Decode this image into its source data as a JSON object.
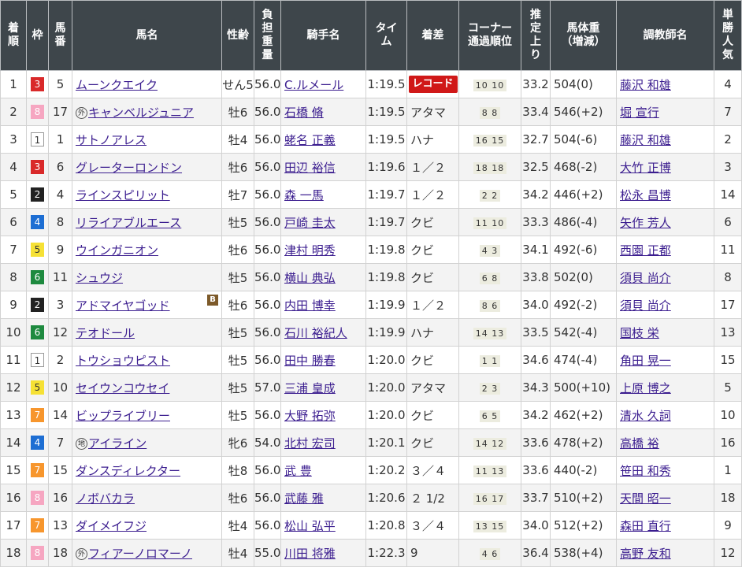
{
  "headers": [
    "着順",
    "枠",
    "馬番",
    "馬名",
    "性齢",
    "負担重量",
    "騎手名",
    "タイム",
    "着差",
    "コーナー通過順位",
    "推定上り",
    "馬体重(増減)",
    "調教師名",
    "単勝人気"
  ],
  "header_lines": [
    [
      "着",
      "順"
    ],
    [
      "枠"
    ],
    [
      "馬",
      "番"
    ],
    [
      "馬名"
    ],
    [
      "性齢"
    ],
    [
      "負",
      "担",
      "重",
      "量"
    ],
    [
      "騎手名"
    ],
    [
      "タイ",
      "ム"
    ],
    [
      "着差"
    ],
    [
      "コーナー",
      "通過順位"
    ],
    [
      "推",
      "定",
      "上",
      "り"
    ],
    [
      "馬体重",
      "（増減）"
    ],
    [
      "調教師名"
    ],
    [
      "単",
      "勝",
      "人",
      "気"
    ]
  ],
  "rows": [
    {
      "pos": "1",
      "waku": "3",
      "num": "5",
      "mark": "",
      "name": "ムーンクエイク",
      "blinker": "",
      "sex": "せん5",
      "wt": "56.0",
      "jockey": "C.ルメール",
      "time": "1:19.5",
      "margin": "",
      "record": "レコード",
      "corner": "10 10",
      "last": "33.2",
      "body": "504(0)",
      "trainer": "藤沢 和雄",
      "pop": "4"
    },
    {
      "pos": "2",
      "waku": "8",
      "num": "17",
      "mark": "外",
      "name": "キャンベルジュニア",
      "blinker": "",
      "sex": "牡6",
      "wt": "56.0",
      "jockey": "石橋 脩",
      "time": "1:19.5",
      "margin": "アタマ",
      "record": "",
      "corner": "8 8",
      "last": "33.4",
      "body": "546(+2)",
      "trainer": "堀 宣行",
      "pop": "7"
    },
    {
      "pos": "3",
      "waku": "1",
      "num": "1",
      "mark": "",
      "name": "サトノアレス",
      "blinker": "",
      "sex": "牡4",
      "wt": "56.0",
      "jockey": "蛯名 正義",
      "time": "1:19.5",
      "margin": "ハナ",
      "record": "",
      "corner": "16 15",
      "last": "32.7",
      "body": "504(-6)",
      "trainer": "藤沢 和雄",
      "pop": "2"
    },
    {
      "pos": "4",
      "waku": "3",
      "num": "6",
      "mark": "",
      "name": "グレーターロンドン",
      "blinker": "",
      "sex": "牡6",
      "wt": "56.0",
      "jockey": "田辺 裕信",
      "time": "1:19.6",
      "margin": "１／２",
      "record": "",
      "corner": "18 18",
      "last": "32.5",
      "body": "468(-2)",
      "trainer": "大竹 正博",
      "pop": "3"
    },
    {
      "pos": "5",
      "waku": "2",
      "num": "4",
      "mark": "",
      "name": "ラインスピリット",
      "blinker": "",
      "sex": "牡7",
      "wt": "56.0",
      "jockey": "森 一馬",
      "time": "1:19.7",
      "margin": "１／２",
      "record": "",
      "corner": "2 2",
      "last": "34.2",
      "body": "446(+2)",
      "trainer": "松永 昌博",
      "pop": "14"
    },
    {
      "pos": "6",
      "waku": "4",
      "num": "8",
      "mark": "",
      "name": "リライアブルエース",
      "blinker": "",
      "sex": "牡5",
      "wt": "56.0",
      "jockey": "戸崎 圭太",
      "time": "1:19.7",
      "margin": "クビ",
      "record": "",
      "corner": "11 10",
      "last": "33.3",
      "body": "486(-4)",
      "trainer": "矢作 芳人",
      "pop": "6"
    },
    {
      "pos": "7",
      "waku": "5",
      "num": "9",
      "mark": "",
      "name": "ウインガニオン",
      "blinker": "",
      "sex": "牡6",
      "wt": "56.0",
      "jockey": "津村 明秀",
      "time": "1:19.8",
      "margin": "クビ",
      "record": "",
      "corner": "4 3",
      "last": "34.1",
      "body": "492(-6)",
      "trainer": "西園 正都",
      "pop": "11"
    },
    {
      "pos": "8",
      "waku": "6",
      "num": "11",
      "mark": "",
      "name": "シュウジ",
      "blinker": "",
      "sex": "牡5",
      "wt": "56.0",
      "jockey": "横山 典弘",
      "time": "1:19.8",
      "margin": "クビ",
      "record": "",
      "corner": "6 8",
      "last": "33.8",
      "body": "502(0)",
      "trainer": "須貝 尚介",
      "pop": "8"
    },
    {
      "pos": "9",
      "waku": "2",
      "num": "3",
      "mark": "",
      "name": "アドマイヤゴッド",
      "blinker": "B",
      "sex": "牡6",
      "wt": "56.0",
      "jockey": "内田 博幸",
      "time": "1:19.9",
      "margin": "１／２",
      "record": "",
      "corner": "8 6",
      "last": "34.0",
      "body": "492(-2)",
      "trainer": "須貝 尚介",
      "pop": "17"
    },
    {
      "pos": "10",
      "waku": "6",
      "num": "12",
      "mark": "",
      "name": "テオドール",
      "blinker": "",
      "sex": "牡5",
      "wt": "56.0",
      "jockey": "石川 裕紀人",
      "time": "1:19.9",
      "margin": "ハナ",
      "record": "",
      "corner": "14 13",
      "last": "33.5",
      "body": "542(-4)",
      "trainer": "国枝 栄",
      "pop": "13"
    },
    {
      "pos": "11",
      "waku": "1",
      "num": "2",
      "mark": "",
      "name": "トウショウピスト",
      "blinker": "",
      "sex": "牡5",
      "wt": "56.0",
      "jockey": "田中 勝春",
      "time": "1:20.0",
      "margin": "クビ",
      "record": "",
      "corner": "1 1",
      "last": "34.6",
      "body": "474(-4)",
      "trainer": "角田 晃一",
      "pop": "15"
    },
    {
      "pos": "12",
      "waku": "5",
      "num": "10",
      "mark": "",
      "name": "セイウンコウセイ",
      "blinker": "",
      "sex": "牡5",
      "wt": "57.0",
      "jockey": "三浦 皇成",
      "time": "1:20.0",
      "margin": "アタマ",
      "record": "",
      "corner": "2 3",
      "last": "34.3",
      "body": "500(+10)",
      "trainer": "上原 博之",
      "pop": "5"
    },
    {
      "pos": "13",
      "waku": "7",
      "num": "14",
      "mark": "",
      "name": "ビップライブリー",
      "blinker": "",
      "sex": "牡5",
      "wt": "56.0",
      "jockey": "大野 拓弥",
      "time": "1:20.0",
      "margin": "クビ",
      "record": "",
      "corner": "6 5",
      "last": "34.2",
      "body": "462(+2)",
      "trainer": "清水 久詞",
      "pop": "10"
    },
    {
      "pos": "14",
      "waku": "4",
      "num": "7",
      "mark": "地",
      "name": "アイライン",
      "blinker": "",
      "sex": "牝6",
      "wt": "54.0",
      "jockey": "北村 宏司",
      "time": "1:20.1",
      "margin": "クビ",
      "record": "",
      "corner": "14 12",
      "last": "33.6",
      "body": "478(+2)",
      "trainer": "高橋 裕",
      "pop": "16"
    },
    {
      "pos": "15",
      "waku": "7",
      "num": "15",
      "mark": "",
      "name": "ダンスディレクター",
      "blinker": "",
      "sex": "牡8",
      "wt": "56.0",
      "jockey": "武 豊",
      "time": "1:20.2",
      "margin": "３／４",
      "record": "",
      "corner": "11 13",
      "last": "33.6",
      "body": "440(-2)",
      "trainer": "笹田 和秀",
      "pop": "1"
    },
    {
      "pos": "16",
      "waku": "8",
      "num": "16",
      "mark": "",
      "name": "ノボバカラ",
      "blinker": "",
      "sex": "牡6",
      "wt": "56.0",
      "jockey": "武藤 雅",
      "time": "1:20.6",
      "margin": "２ 1/2",
      "record": "",
      "corner": "16 17",
      "last": "33.7",
      "body": "510(+2)",
      "trainer": "天間 昭一",
      "pop": "18"
    },
    {
      "pos": "17",
      "waku": "7",
      "num": "13",
      "mark": "",
      "name": "ダイメイフジ",
      "blinker": "",
      "sex": "牡4",
      "wt": "56.0",
      "jockey": "松山 弘平",
      "time": "1:20.8",
      "margin": "３／４",
      "record": "",
      "corner": "13 15",
      "last": "34.0",
      "body": "512(+2)",
      "trainer": "森田 直行",
      "pop": "9"
    },
    {
      "pos": "18",
      "waku": "8",
      "num": "18",
      "mark": "外",
      "name": "フィアーノロマーノ",
      "blinker": "",
      "sex": "牡4",
      "wt": "55.0",
      "jockey": "川田 将雅",
      "time": "1:22.3",
      "margin": "9",
      "record": "",
      "corner": "4 6",
      "last": "36.4",
      "body": "538(+4)",
      "trainer": "高野 友和",
      "pop": "12"
    }
  ]
}
